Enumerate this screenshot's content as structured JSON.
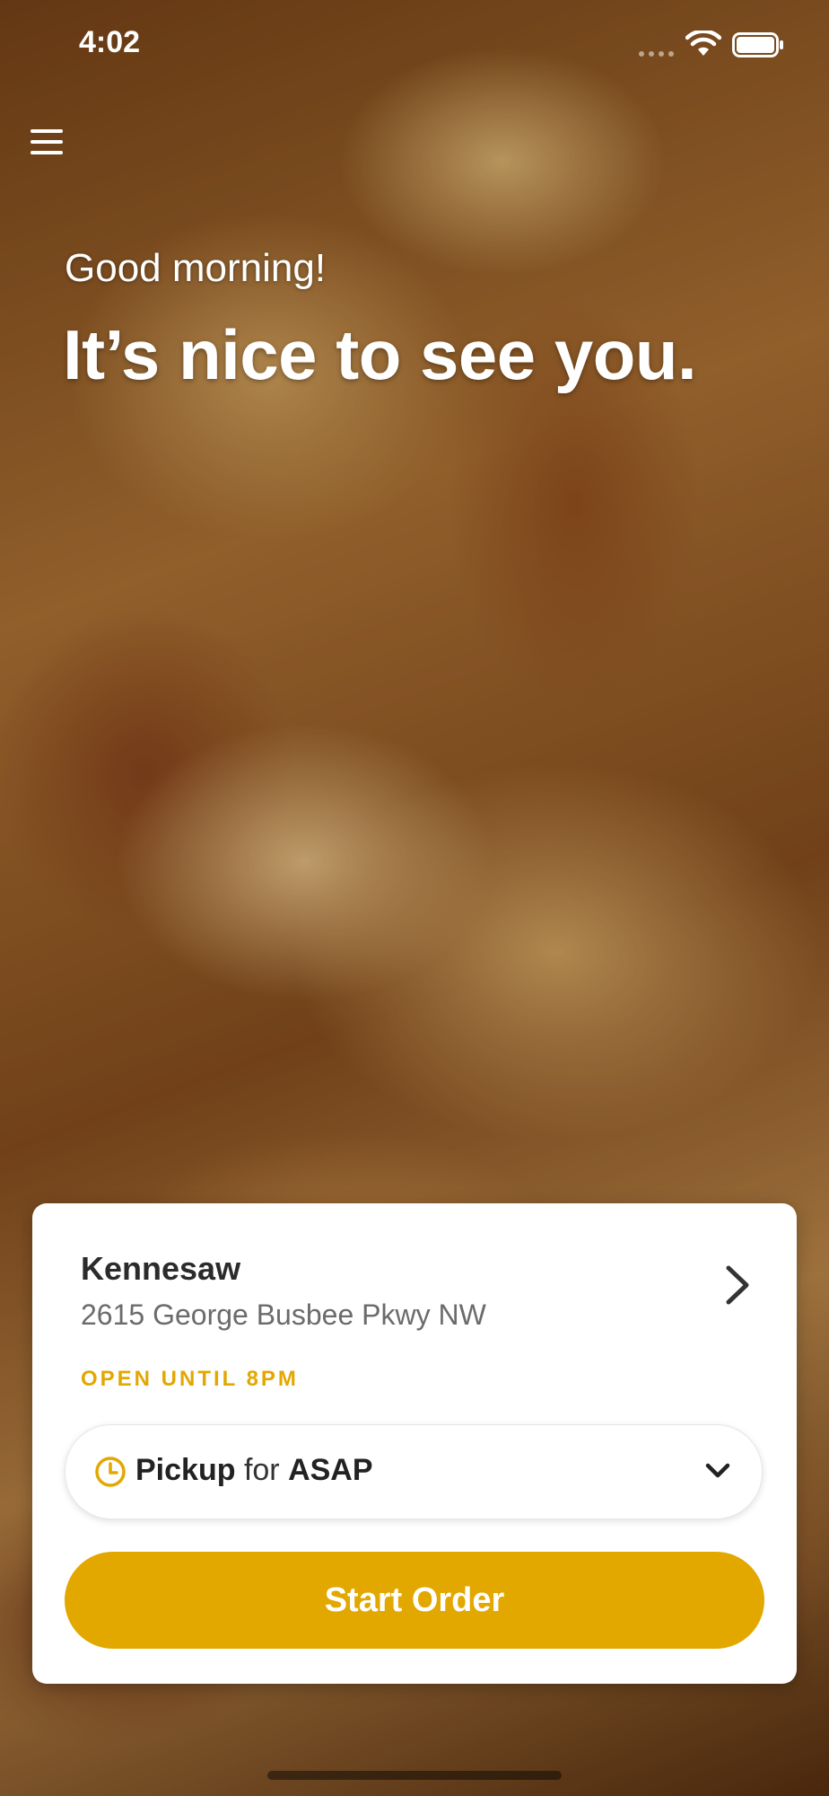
{
  "status_bar": {
    "time": "4:02",
    "wifi_icon": "wifi-icon",
    "battery_icon": "battery-icon"
  },
  "header": {
    "menu_icon": "hamburger-menu-icon"
  },
  "hero": {
    "greeting": "Good morning!",
    "headline": "It’s nice to see you.",
    "background_image": "rotisserie-chicken-photo"
  },
  "store_card": {
    "location_name": "Kennesaw",
    "address": "2615 George Busbee Pkwy NW",
    "open_status": "OPEN UNTIL 8PM",
    "order_mode": {
      "mode": "Pickup",
      "connector": "for",
      "time": "ASAP",
      "clock_icon": "clock-icon",
      "chevron_icon": "chevron-down-icon"
    },
    "start_order_label": "Start Order",
    "chevron_icon": "chevron-right-icon"
  },
  "colors": {
    "accent": "#E2A800",
    "card_background": "#FFFFFF",
    "text_primary": "#2B2B2B",
    "text_secondary": "#6B6B6B"
  }
}
